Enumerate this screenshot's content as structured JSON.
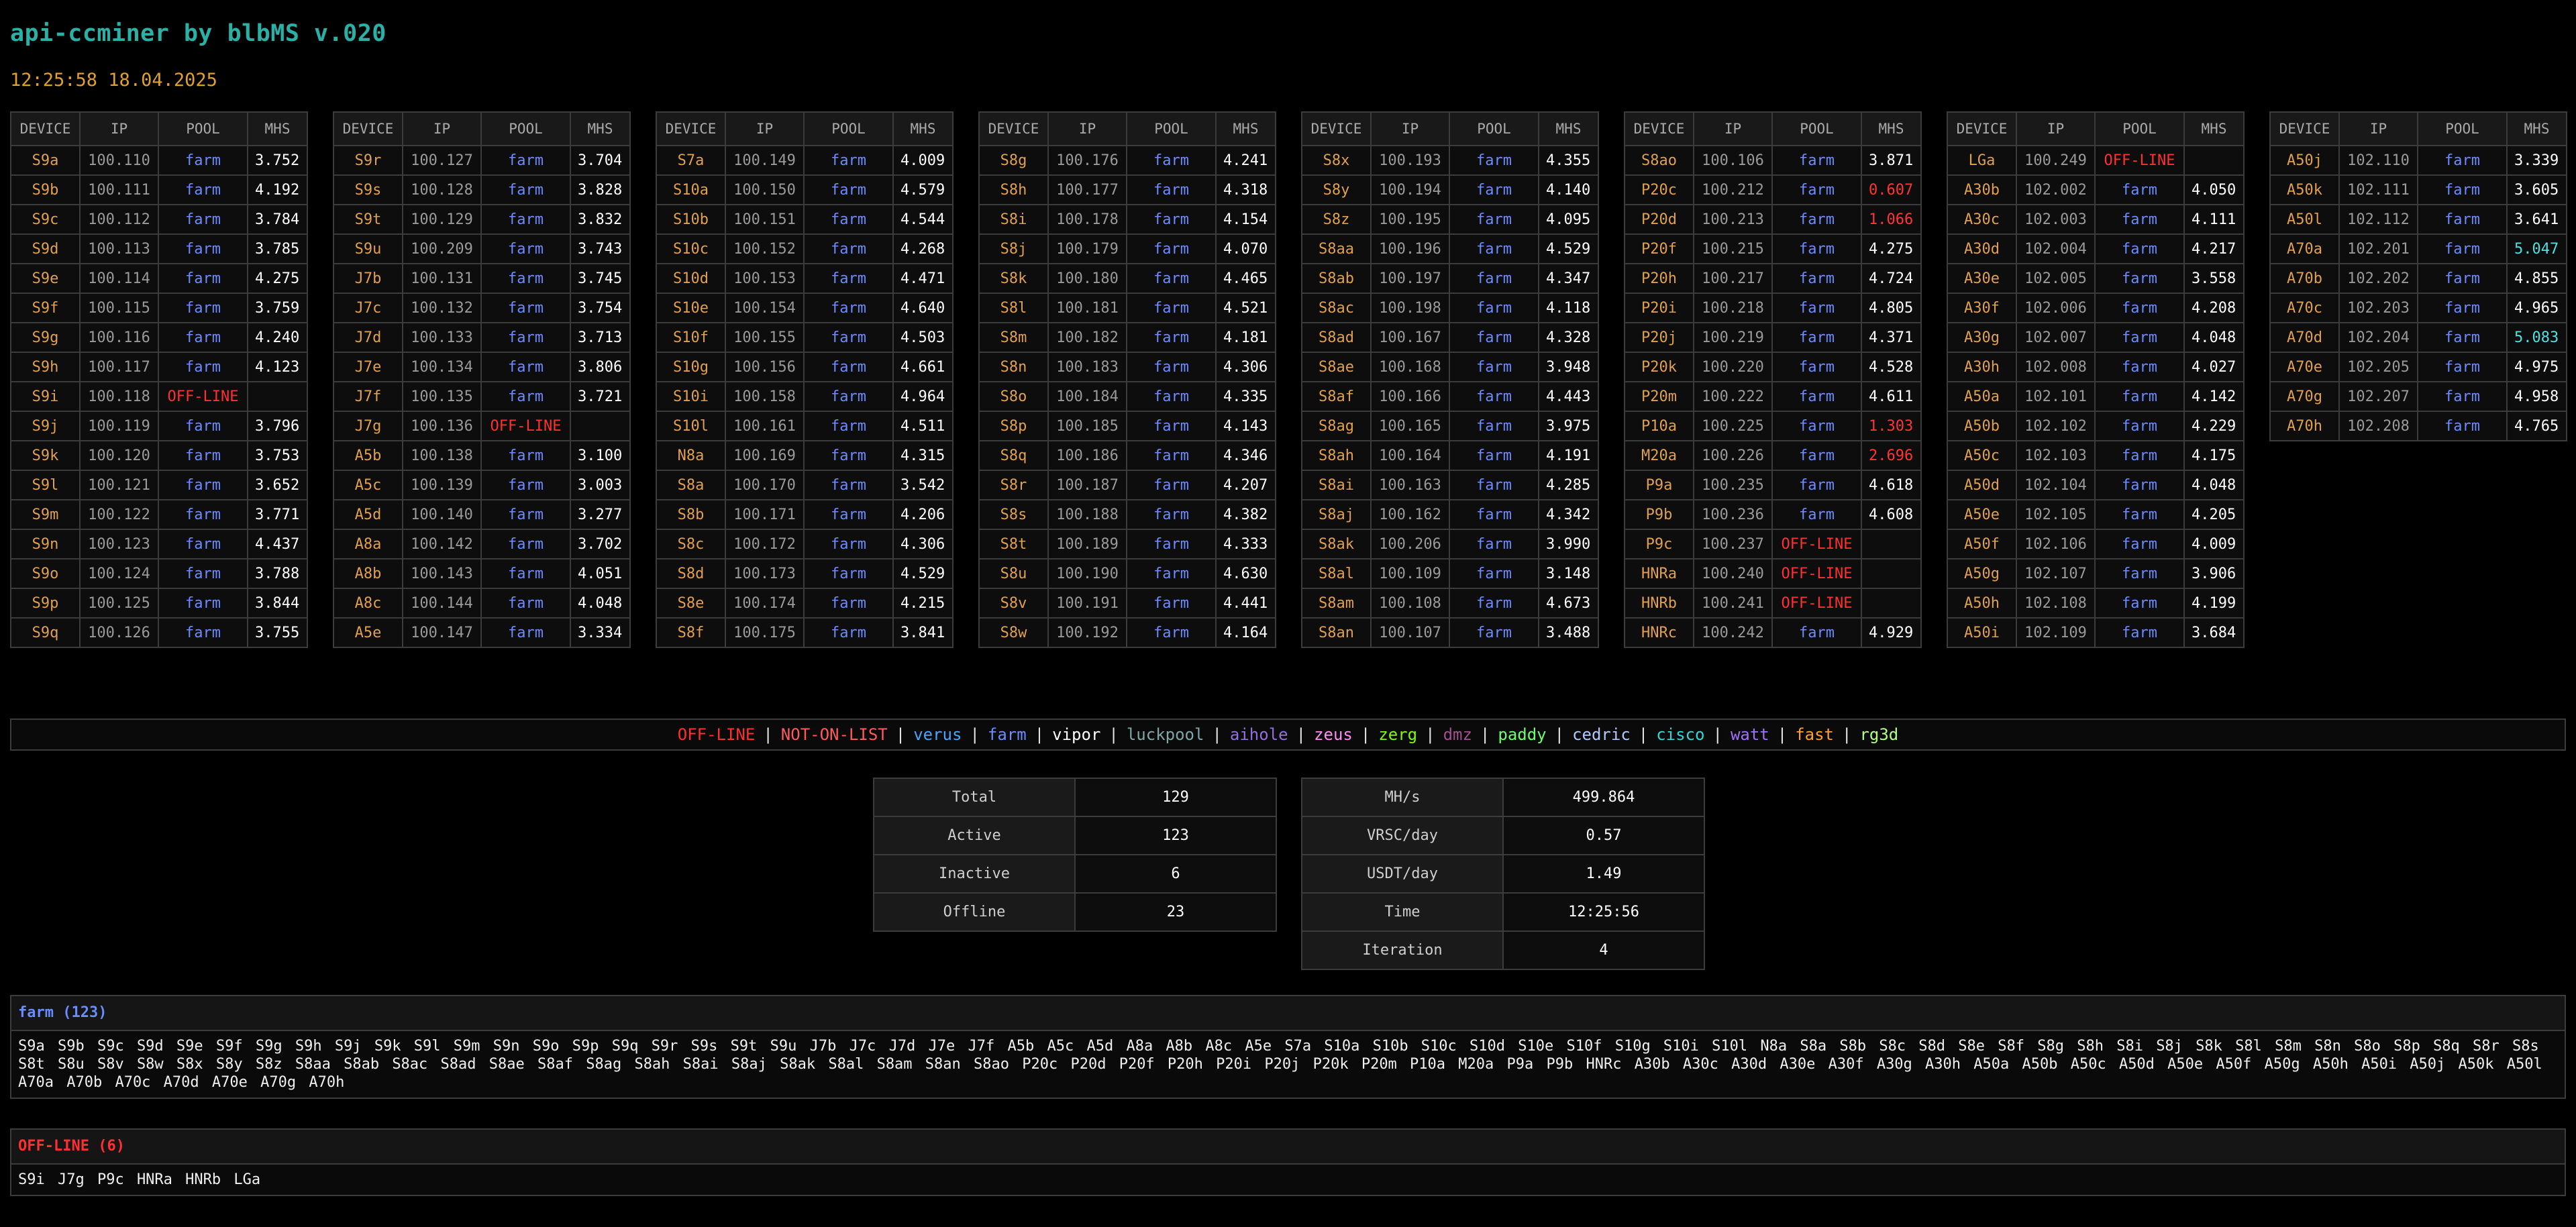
{
  "header": {
    "title": "api-ccminer by blbMS v.020",
    "clock": "12:25:58 18.04.2025"
  },
  "columns": {
    "device": "DEVICE",
    "ip": "IP",
    "pool": "POOL",
    "mhs": "MHS"
  },
  "device_tables": [
    [
      [
        "S9a",
        "100.110",
        "farm",
        "3.752"
      ],
      [
        "S9b",
        "100.111",
        "farm",
        "4.192"
      ],
      [
        "S9c",
        "100.112",
        "farm",
        "3.784"
      ],
      [
        "S9d",
        "100.113",
        "farm",
        "3.785"
      ],
      [
        "S9e",
        "100.114",
        "farm",
        "4.275"
      ],
      [
        "S9f",
        "100.115",
        "farm",
        "3.759"
      ],
      [
        "S9g",
        "100.116",
        "farm",
        "4.240"
      ],
      [
        "S9h",
        "100.117",
        "farm",
        "4.123"
      ],
      [
        "S9i",
        "100.118",
        "OFF-LINE",
        ""
      ],
      [
        "S9j",
        "100.119",
        "farm",
        "3.796"
      ],
      [
        "S9k",
        "100.120",
        "farm",
        "3.753"
      ],
      [
        "S9l",
        "100.121",
        "farm",
        "3.652"
      ],
      [
        "S9m",
        "100.122",
        "farm",
        "3.771"
      ],
      [
        "S9n",
        "100.123",
        "farm",
        "4.437"
      ],
      [
        "S9o",
        "100.124",
        "farm",
        "3.788"
      ],
      [
        "S9p",
        "100.125",
        "farm",
        "3.844"
      ],
      [
        "S9q",
        "100.126",
        "farm",
        "3.755"
      ]
    ],
    [
      [
        "S9r",
        "100.127",
        "farm",
        "3.704"
      ],
      [
        "S9s",
        "100.128",
        "farm",
        "3.828"
      ],
      [
        "S9t",
        "100.129",
        "farm",
        "3.832"
      ],
      [
        "S9u",
        "100.209",
        "farm",
        "3.743"
      ],
      [
        "J7b",
        "100.131",
        "farm",
        "3.745"
      ],
      [
        "J7c",
        "100.132",
        "farm",
        "3.754"
      ],
      [
        "J7d",
        "100.133",
        "farm",
        "3.713"
      ],
      [
        "J7e",
        "100.134",
        "farm",
        "3.806"
      ],
      [
        "J7f",
        "100.135",
        "farm",
        "3.721"
      ],
      [
        "J7g",
        "100.136",
        "OFF-LINE",
        ""
      ],
      [
        "A5b",
        "100.138",
        "farm",
        "3.100"
      ],
      [
        "A5c",
        "100.139",
        "farm",
        "3.003"
      ],
      [
        "A5d",
        "100.140",
        "farm",
        "3.277"
      ],
      [
        "A8a",
        "100.142",
        "farm",
        "3.702"
      ],
      [
        "A8b",
        "100.143",
        "farm",
        "4.051"
      ],
      [
        "A8c",
        "100.144",
        "farm",
        "4.048"
      ],
      [
        "A5e",
        "100.147",
        "farm",
        "3.334"
      ]
    ],
    [
      [
        "S7a",
        "100.149",
        "farm",
        "4.009"
      ],
      [
        "S10a",
        "100.150",
        "farm",
        "4.579"
      ],
      [
        "S10b",
        "100.151",
        "farm",
        "4.544"
      ],
      [
        "S10c",
        "100.152",
        "farm",
        "4.268"
      ],
      [
        "S10d",
        "100.153",
        "farm",
        "4.471"
      ],
      [
        "S10e",
        "100.154",
        "farm",
        "4.640"
      ],
      [
        "S10f",
        "100.155",
        "farm",
        "4.503"
      ],
      [
        "S10g",
        "100.156",
        "farm",
        "4.661"
      ],
      [
        "S10i",
        "100.158",
        "farm",
        "4.964"
      ],
      [
        "S10l",
        "100.161",
        "farm",
        "4.511"
      ],
      [
        "N8a",
        "100.169",
        "farm",
        "4.315"
      ],
      [
        "S8a",
        "100.170",
        "farm",
        "3.542"
      ],
      [
        "S8b",
        "100.171",
        "farm",
        "4.206"
      ],
      [
        "S8c",
        "100.172",
        "farm",
        "4.306"
      ],
      [
        "S8d",
        "100.173",
        "farm",
        "4.529"
      ],
      [
        "S8e",
        "100.174",
        "farm",
        "4.215"
      ],
      [
        "S8f",
        "100.175",
        "farm",
        "3.841"
      ]
    ],
    [
      [
        "S8g",
        "100.176",
        "farm",
        "4.241"
      ],
      [
        "S8h",
        "100.177",
        "farm",
        "4.318"
      ],
      [
        "S8i",
        "100.178",
        "farm",
        "4.154"
      ],
      [
        "S8j",
        "100.179",
        "farm",
        "4.070"
      ],
      [
        "S8k",
        "100.180",
        "farm",
        "4.465"
      ],
      [
        "S8l",
        "100.181",
        "farm",
        "4.521"
      ],
      [
        "S8m",
        "100.182",
        "farm",
        "4.181"
      ],
      [
        "S8n",
        "100.183",
        "farm",
        "4.306"
      ],
      [
        "S8o",
        "100.184",
        "farm",
        "4.335"
      ],
      [
        "S8p",
        "100.185",
        "farm",
        "4.143"
      ],
      [
        "S8q",
        "100.186",
        "farm",
        "4.346"
      ],
      [
        "S8r",
        "100.187",
        "farm",
        "4.207"
      ],
      [
        "S8s",
        "100.188",
        "farm",
        "4.382"
      ],
      [
        "S8t",
        "100.189",
        "farm",
        "4.333"
      ],
      [
        "S8u",
        "100.190",
        "farm",
        "4.630"
      ],
      [
        "S8v",
        "100.191",
        "farm",
        "4.441"
      ],
      [
        "S8w",
        "100.192",
        "farm",
        "4.164"
      ]
    ],
    [
      [
        "S8x",
        "100.193",
        "farm",
        "4.355"
      ],
      [
        "S8y",
        "100.194",
        "farm",
        "4.140"
      ],
      [
        "S8z",
        "100.195",
        "farm",
        "4.095"
      ],
      [
        "S8aa",
        "100.196",
        "farm",
        "4.529"
      ],
      [
        "S8ab",
        "100.197",
        "farm",
        "4.347"
      ],
      [
        "S8ac",
        "100.198",
        "farm",
        "4.118"
      ],
      [
        "S8ad",
        "100.167",
        "farm",
        "4.328"
      ],
      [
        "S8ae",
        "100.168",
        "farm",
        "3.948"
      ],
      [
        "S8af",
        "100.166",
        "farm",
        "4.443"
      ],
      [
        "S8ag",
        "100.165",
        "farm",
        "3.975"
      ],
      [
        "S8ah",
        "100.164",
        "farm",
        "4.191"
      ],
      [
        "S8ai",
        "100.163",
        "farm",
        "4.285"
      ],
      [
        "S8aj",
        "100.162",
        "farm",
        "4.342"
      ],
      [
        "S8ak",
        "100.206",
        "farm",
        "3.990"
      ],
      [
        "S8al",
        "100.109",
        "farm",
        "3.148"
      ],
      [
        "S8am",
        "100.108",
        "farm",
        "4.673"
      ],
      [
        "S8an",
        "100.107",
        "farm",
        "3.488"
      ]
    ],
    [
      [
        "S8ao",
        "100.106",
        "farm",
        "3.871"
      ],
      [
        "P20c",
        "100.212",
        "farm",
        "0.607"
      ],
      [
        "P20d",
        "100.213",
        "farm",
        "1.066"
      ],
      [
        "P20f",
        "100.215",
        "farm",
        "4.275"
      ],
      [
        "P20h",
        "100.217",
        "farm",
        "4.724"
      ],
      [
        "P20i",
        "100.218",
        "farm",
        "4.805"
      ],
      [
        "P20j",
        "100.219",
        "farm",
        "4.371"
      ],
      [
        "P20k",
        "100.220",
        "farm",
        "4.528"
      ],
      [
        "P20m",
        "100.222",
        "farm",
        "4.611"
      ],
      [
        "P10a",
        "100.225",
        "farm",
        "1.303"
      ],
      [
        "M20a",
        "100.226",
        "farm",
        "2.696"
      ],
      [
        "P9a",
        "100.235",
        "farm",
        "4.618"
      ],
      [
        "P9b",
        "100.236",
        "farm",
        "4.608"
      ],
      [
        "P9c",
        "100.237",
        "OFF-LINE",
        ""
      ],
      [
        "HNRa",
        "100.240",
        "OFF-LINE",
        ""
      ],
      [
        "HNRb",
        "100.241",
        "OFF-LINE",
        ""
      ],
      [
        "HNRc",
        "100.242",
        "farm",
        "4.929"
      ]
    ],
    [
      [
        "LGa",
        "100.249",
        "OFF-LINE",
        ""
      ],
      [
        "A30b",
        "102.002",
        "farm",
        "4.050"
      ],
      [
        "A30c",
        "102.003",
        "farm",
        "4.111"
      ],
      [
        "A30d",
        "102.004",
        "farm",
        "4.217"
      ],
      [
        "A30e",
        "102.005",
        "farm",
        "3.558"
      ],
      [
        "A30f",
        "102.006",
        "farm",
        "4.208"
      ],
      [
        "A30g",
        "102.007",
        "farm",
        "4.048"
      ],
      [
        "A30h",
        "102.008",
        "farm",
        "4.027"
      ],
      [
        "A50a",
        "102.101",
        "farm",
        "4.142"
      ],
      [
        "A50b",
        "102.102",
        "farm",
        "4.229"
      ],
      [
        "A50c",
        "102.103",
        "farm",
        "4.175"
      ],
      [
        "A50d",
        "102.104",
        "farm",
        "4.048"
      ],
      [
        "A50e",
        "102.105",
        "farm",
        "4.205"
      ],
      [
        "A50f",
        "102.106",
        "farm",
        "4.009"
      ],
      [
        "A50g",
        "102.107",
        "farm",
        "3.906"
      ],
      [
        "A50h",
        "102.108",
        "farm",
        "4.199"
      ],
      [
        "A50i",
        "102.109",
        "farm",
        "3.684"
      ]
    ],
    [
      [
        "A50j",
        "102.110",
        "farm",
        "3.339"
      ],
      [
        "A50k",
        "102.111",
        "farm",
        "3.605"
      ],
      [
        "A50l",
        "102.112",
        "farm",
        "3.641"
      ],
      [
        "A70a",
        "102.201",
        "farm",
        "5.047"
      ],
      [
        "A70b",
        "102.202",
        "farm",
        "4.855"
      ],
      [
        "A70c",
        "102.203",
        "farm",
        "4.965"
      ],
      [
        "A70d",
        "102.204",
        "farm",
        "5.083"
      ],
      [
        "A70e",
        "102.205",
        "farm",
        "4.975"
      ],
      [
        "A70g",
        "102.207",
        "farm",
        "4.958"
      ],
      [
        "A70h",
        "102.208",
        "farm",
        "4.765"
      ]
    ]
  ],
  "legend": [
    {
      "label": "OFF-LINE",
      "color": "#ff3030"
    },
    {
      "label": "NOT-ON-LIST",
      "color": "#ff5a5a"
    },
    {
      "label": "verus",
      "color": "#4aa3ff"
    },
    {
      "label": "farm",
      "color": "#6a8cff"
    },
    {
      "label": "vipor",
      "color": "#ffffff"
    },
    {
      "label": "luckpool",
      "color": "#7fa7a7"
    },
    {
      "label": "aihole",
      "color": "#9370db"
    },
    {
      "label": "zeus",
      "color": "#ff8cf0"
    },
    {
      "label": "zerg",
      "color": "#7cfc00"
    },
    {
      "label": "dmz",
      "color": "#a0508f"
    },
    {
      "label": "paddy",
      "color": "#6cff6c"
    },
    {
      "label": "cedric",
      "color": "#b0c8ff"
    },
    {
      "label": "cisco",
      "color": "#33d6d6"
    },
    {
      "label": "watt",
      "color": "#a070ff"
    },
    {
      "label": "fast",
      "color": "#ffa030"
    },
    {
      "label": "rg3d",
      "color": "#b0ff80"
    }
  ],
  "stats_left": [
    {
      "label": "Total",
      "value": "129"
    },
    {
      "label": "Active",
      "value": "123"
    },
    {
      "label": "Inactive",
      "value": "6"
    },
    {
      "label": "Offline",
      "value": "23"
    }
  ],
  "stats_right": [
    {
      "label": "MH/s",
      "value": "499.864"
    },
    {
      "label": "VRSC/day",
      "value": "0.57"
    },
    {
      "label": "USDT/day",
      "value": "1.49"
    },
    {
      "label": "Time",
      "value": "12:25:56"
    },
    {
      "label": "Iteration",
      "value": "4"
    }
  ],
  "farm_panel": {
    "title": "farm (123)",
    "title_color": "#6a8cff",
    "devices": "S9a S9b S9c S9d S9e S9f S9g S9h S9j S9k S9l S9m S9n S9o S9p S9q S9r S9s S9t S9u J7b J7c J7d J7e J7f A5b A5c A5d A8a A8b A8c A5e S7a S10a S10b S10c S10d S10e S10f S10g S10i S10l N8a S8a S8b S8c S8d S8e S8f S8g S8h S8i S8j S8k S8l S8m S8n S8o S8p S8q S8r S8s S8t S8u S8v S8w S8x S8y S8z S8aa S8ab S8ac S8ad S8ae S8af S8ag S8ah S8ai S8aj S8ak S8al S8am S8an S8ao P20c P20d P20f P20h P20i P20j P20k P20m P10a M20a P9a P9b HNRc A30b A30c A30d A30e A30f A30g A30h A50a A50b A50c A50d A50e A50f A50g A50h A50i A50j A50k A50l A70a A70b A70c A70d A70e A70g A70h"
  },
  "offline_panel": {
    "title": "OFF-LINE (6)",
    "title_color": "#ff3030",
    "devices": "S9i J7g P9c HNRa HNRb LGa"
  },
  "thresholds": {
    "low_below": 3.0,
    "high_above": 5.0
  },
  "colors": {
    "farm": "#6a8cff",
    "offline": "#ff3030",
    "low": "#ff3535",
    "high": "#4fe0e0",
    "device": "#e0a050"
  }
}
